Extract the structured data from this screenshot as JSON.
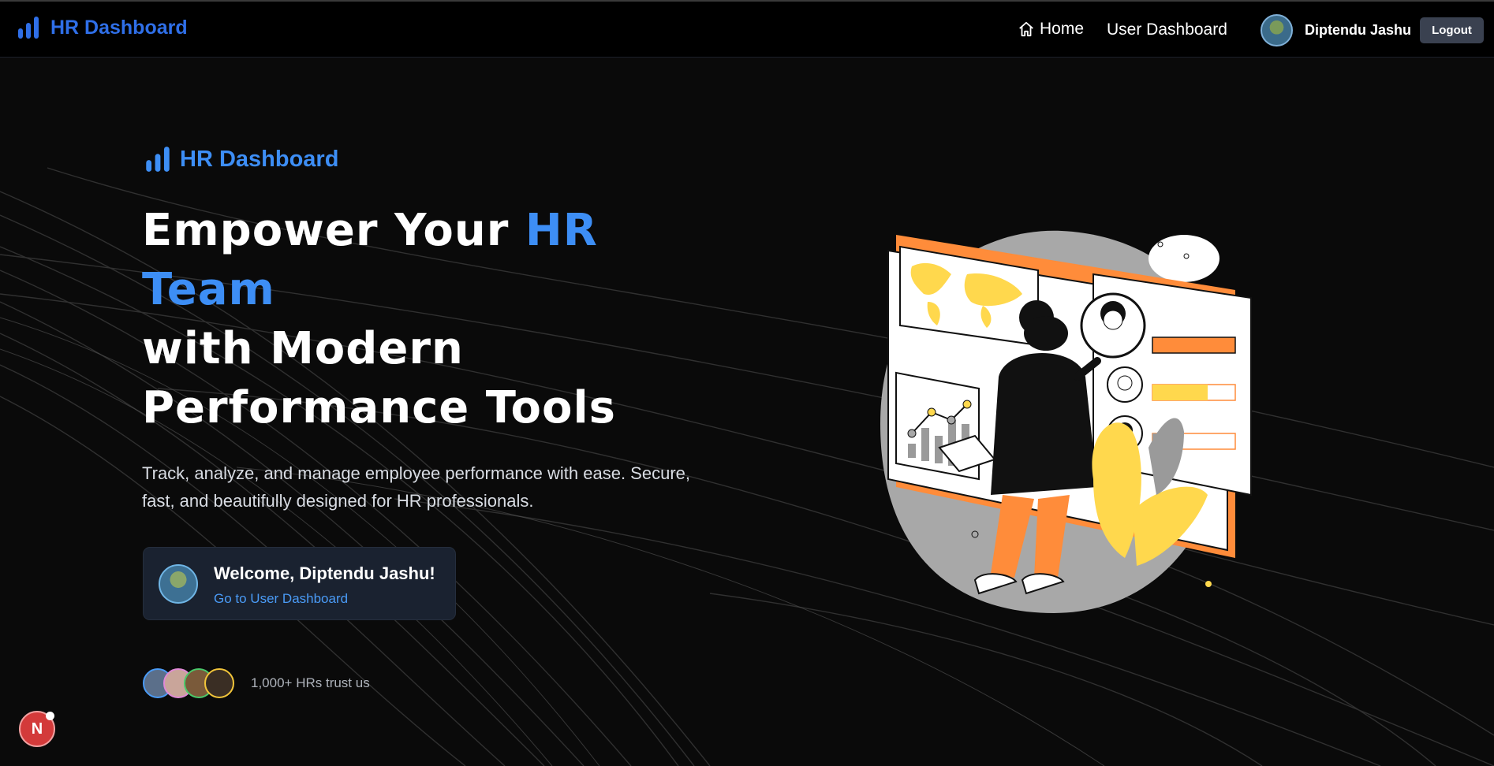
{
  "navbar": {
    "brand": "HR Dashboard",
    "home_label": "Home",
    "user_dashboard_label": "User Dashboard",
    "username": "Diptendu Jashu",
    "logout_label": "Logout"
  },
  "hero": {
    "brand": "HR Dashboard",
    "title_part1": "Empower Your ",
    "title_accent": "HR Team",
    "title_part2": "with Modern Performance Tools",
    "description": "Track, analyze, and manage employee performance with ease. Secure, fast, and beautifully designed for HR professionals.",
    "welcome_title": "Welcome, Diptendu Jashu!",
    "welcome_link": "Go to User Dashboard",
    "trust_text": "1,000+ HRs trust us"
  },
  "floating_badge": {
    "letter": "N"
  },
  "colors": {
    "brand_blue": "#2f6fe8",
    "accent_blue": "#3d8ef5",
    "illustration_orange": "#ff8c3a",
    "illustration_yellow": "#ffd84d"
  },
  "icons": [
    "bar-chart-icon",
    "home-icon"
  ]
}
